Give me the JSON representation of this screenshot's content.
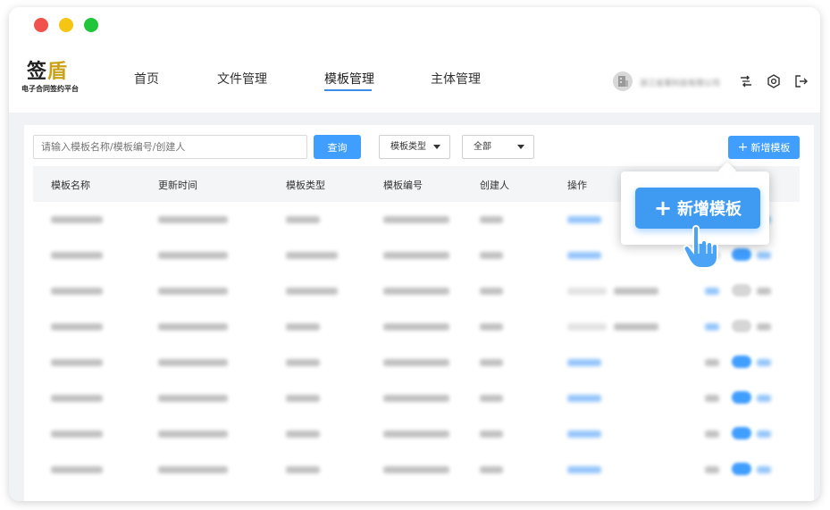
{
  "logo": {
    "main_prefix": "签",
    "main_accent": "盾",
    "subtitle": "电子合同签约平台"
  },
  "nav": [
    {
      "label": "首页"
    },
    {
      "label": "文件管理"
    },
    {
      "label": "模板管理"
    },
    {
      "label": "主体管理"
    }
  ],
  "nav_active": "模板管理",
  "user": {
    "name": "浙江省某科技有限公司"
  },
  "header_icons": [
    "switch-icon",
    "settings-icon",
    "logout-icon"
  ],
  "toolbar": {
    "search_placeholder": "请输入模板名称/模板编号/创建人",
    "search_button": "查询",
    "type_select": "模板类型",
    "status_select": "全部",
    "add_button": "新增模板"
  },
  "table": {
    "columns": [
      "模板名称",
      "更新时间",
      "模板类型",
      "模板编号",
      "创建人",
      "操作"
    ]
  },
  "popup": {
    "add_button": "新增模板"
  },
  "colors": {
    "primary": "#409eff",
    "header_bg": "#f4f5f7",
    "content_bg": "#f0f2f5"
  }
}
